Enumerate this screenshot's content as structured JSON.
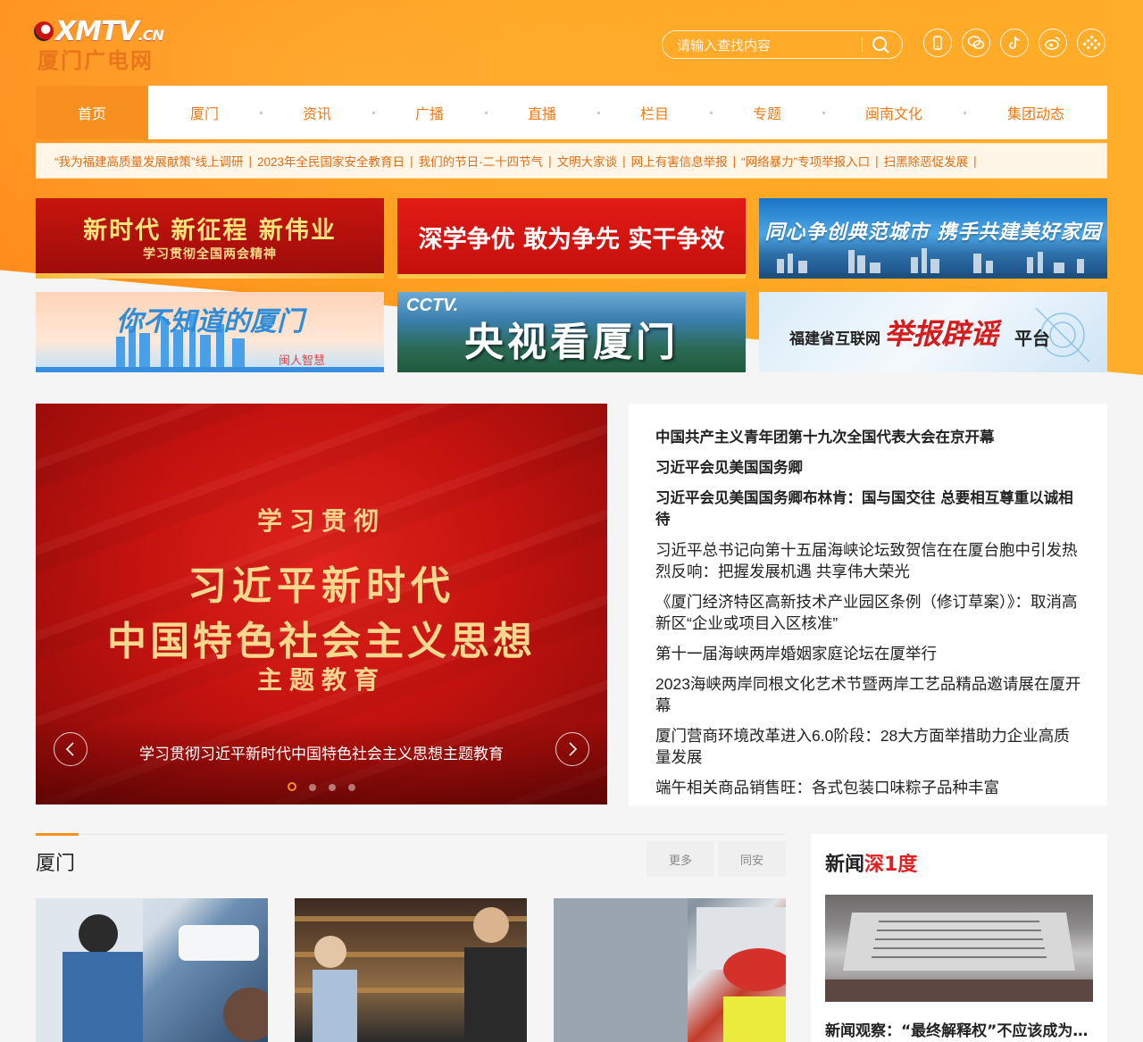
{
  "header": {
    "logo_en": "XMTV",
    "logo_en_suffix": ".CN",
    "logo_cn": "厦门广电网",
    "search_placeholder": "请输入查找内容"
  },
  "social_icons": [
    "mobile-icon",
    "wechat-icon",
    "douyin-icon",
    "weibo-icon",
    "app-grid-icon"
  ],
  "nav": {
    "items": [
      {
        "label": "首页",
        "active": true
      },
      {
        "label": "厦门"
      },
      {
        "label": "资讯"
      },
      {
        "label": "广播"
      },
      {
        "label": "直播"
      },
      {
        "label": "栏目"
      },
      {
        "label": "专题"
      },
      {
        "label": "闽南文化"
      },
      {
        "label": "集团动态"
      }
    ]
  },
  "quick_links": [
    "“我为福建高质量发展献策”线上调研",
    "2023年全民国家安全教育日",
    "我们的节日·二十四节气",
    "文明大家谈",
    "网上有害信息举报",
    "“网络暴力”专项举报入口",
    "扫黑除恶促发展"
  ],
  "banners": {
    "b1_title": "新时代 新征程 新伟业",
    "b1_sub": "学习贯彻全国两会精神",
    "b2_title": "深学争优 敢为争先 实干争效",
    "b3_title": "同心争创典范城市 携手共建美好家园",
    "b4_title": "你不知道的厦门",
    "b4_sub": "闽人智慧",
    "b5_logo": "CCTV.",
    "b5_title": "央视看厦门",
    "b6_pre": "福建省互联网",
    "b6_main": "举报辟谣",
    "b6_post": "平台"
  },
  "carousel": {
    "line1": "学习贯彻",
    "line2": "习近平新时代",
    "line3": "中国特色社会主义思想",
    "line4": "主题教育",
    "caption": "学习贯彻习近平新时代中国特色社会主义思想主题教育",
    "slide_count": 4,
    "active_slide": 1
  },
  "headlines": [
    {
      "text": "中国共产主义青年团第十九次全国代表大会在京开幕",
      "bold": true
    },
    {
      "text": "习近平会见美国国务卿",
      "bold": true
    },
    {
      "text": "习近平会见美国国务卿布林肯：国与国交往 总要相互尊重以诚相待",
      "bold": true
    },
    {
      "text": "习近平总书记向第十五届海峡论坛致贺信在在厦台胞中引发热烈反响：把握发展机遇 共享伟大荣光",
      "bold": false
    },
    {
      "text": "《厦门经济特区高新技术产业园区条例（修订草案）》：取消高新区“企业或项目入区核准”",
      "bold": false
    },
    {
      "text": "第十一届海峡两岸婚姻家庭论坛在厦举行",
      "bold": false
    },
    {
      "text": "2023海峡两岸同根文化艺术节暨两岸工艺品精品邀请展在厦开幕",
      "bold": false
    },
    {
      "text": "厦门营商环境改革进入6.0阶段：28大方面举措助力企业高质量发展",
      "bold": false
    },
    {
      "text": "端午相关商品销售旺：各式包装口味粽子品种丰富",
      "bold": false
    }
  ],
  "section_xiamen": {
    "title": "厦门",
    "tabs": [
      "更多",
      "同安"
    ]
  },
  "news_depth": {
    "logo_a": "新闻",
    "logo_b": "深1度",
    "caption": "新闻观察：“最终解释权”不应该成为商家的“免责金牌”"
  }
}
